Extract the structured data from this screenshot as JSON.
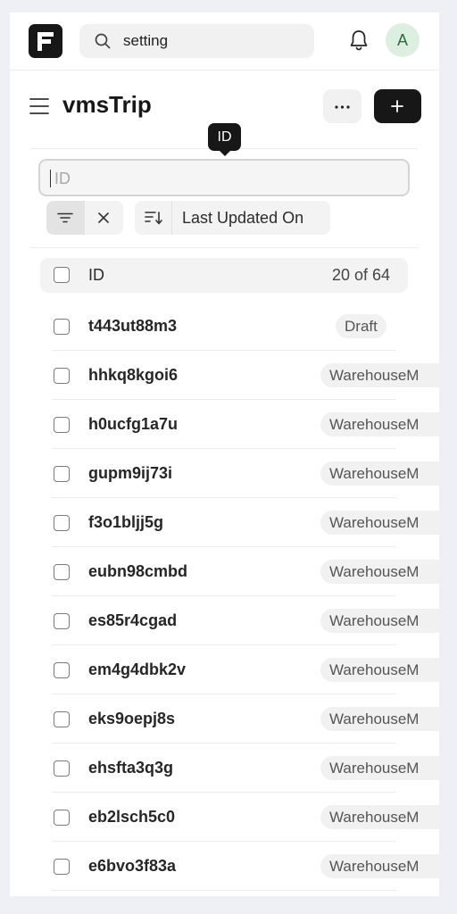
{
  "topbar": {
    "search_value": "setting",
    "avatar_initial": "A"
  },
  "header": {
    "title": "vmsTrip",
    "more_icon": "ellipsis-icon",
    "add_icon": "plus-icon"
  },
  "tooltip": {
    "text": "ID"
  },
  "filter": {
    "id_placeholder": "ID",
    "sort_field": "Last Updated On"
  },
  "list": {
    "header_label": "ID",
    "count_text": "20 of 64",
    "rows": [
      {
        "id": "t443ut88m3",
        "status": "Draft"
      },
      {
        "id": "hhkq8kgoi6",
        "status": "WarehouseM"
      },
      {
        "id": "h0ucfg1a7u",
        "status": "WarehouseM"
      },
      {
        "id": "gupm9ij73i",
        "status": "WarehouseM"
      },
      {
        "id": "f3o1bljj5g",
        "status": "WarehouseM"
      },
      {
        "id": "eubn98cmbd",
        "status": "WarehouseM"
      },
      {
        "id": "es85r4cgad",
        "status": "WarehouseM"
      },
      {
        "id": "em4g4dbk2v",
        "status": "WarehouseM"
      },
      {
        "id": "eks9oepj8s",
        "status": "WarehouseM"
      },
      {
        "id": "ehsfta3q3g",
        "status": "WarehouseM"
      },
      {
        "id": "eb2lsch5c0",
        "status": "WarehouseM"
      },
      {
        "id": "e6bvo3f83a",
        "status": "WarehouseM"
      }
    ]
  }
}
